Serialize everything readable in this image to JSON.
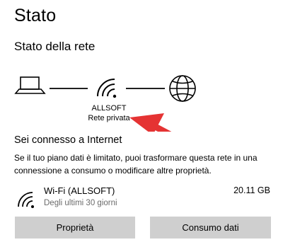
{
  "page": {
    "title": "Stato"
  },
  "network_status": {
    "title": "Stato della rete",
    "network_name": "ALLSOFT",
    "network_type": "Rete privata",
    "icons": [
      "laptop-icon",
      "wifi-icon",
      "globe-icon"
    ],
    "annotation": {
      "shape": "red-arrow",
      "color": "#e53333"
    }
  },
  "connection": {
    "title": "Sei connesso a Internet",
    "description": "Se il tuo piano dati è limitato, puoi trasformare questa rete in una connessione a consumo o modificare altre proprietà."
  },
  "adapter": {
    "icon": "wifi-icon",
    "name": "Wi-Fi (ALLSOFT)",
    "period": "Degli ultimi 30 giorni",
    "usage": "20.11 GB"
  },
  "buttons": {
    "properties": "Proprietà",
    "data_usage": "Consumo dati"
  }
}
